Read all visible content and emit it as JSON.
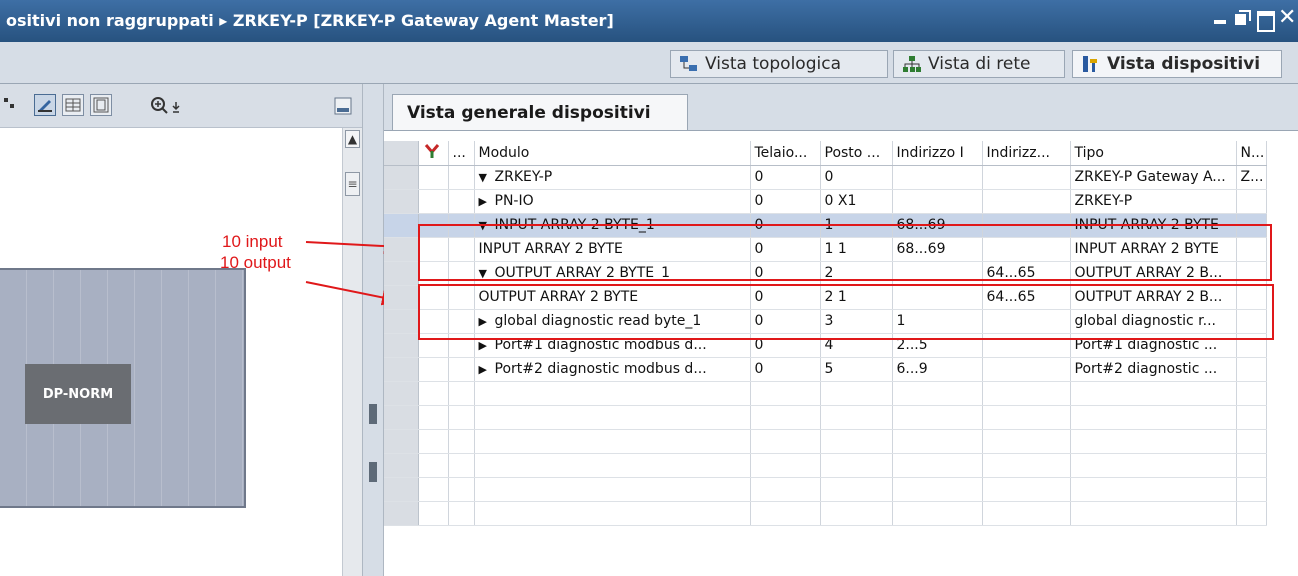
{
  "window": {
    "title": "ositivi non raggruppati ▸ ZRKEY-P [ZRKEY-P Gateway Agent Master]"
  },
  "view_tabs": [
    {
      "label": "Vista topologica",
      "icon": "topology-view-icon"
    },
    {
      "label": "Vista di rete",
      "icon": "network-view-icon"
    },
    {
      "label": "Vista dispositivi",
      "icon": "device-view-icon"
    }
  ],
  "left_panel": {
    "device_module_label": "DP-NORM",
    "annotations": [
      "10 input",
      "10 output"
    ]
  },
  "overview_tab": "Vista generale dispositivi",
  "table": {
    "columns": [
      "",
      "",
      "...",
      "Modulo",
      "Telaio...",
      "Posto ...",
      "Indirizzo I",
      "Indirizz...",
      "Tipo",
      "N..."
    ],
    "rows": [
      {
        "tree": "▼",
        "modulo": "ZRKEY-P",
        "telaio": "0",
        "posto": "0",
        "in": "",
        "out": "",
        "tipo": "ZRKEY-P Gateway A...",
        "n": "Z...",
        "level": 0
      },
      {
        "tree": "▶",
        "modulo": "PN-IO",
        "telaio": "0",
        "posto": "0 X1",
        "in": "",
        "out": "",
        "tipo": "ZRKEY-P",
        "n": "",
        "level": 1
      },
      {
        "tree": "▼",
        "modulo": "INPUT ARRAY 2 BYTE_1",
        "telaio": "0",
        "posto": "1",
        "in": "68...69",
        "out": "",
        "tipo": "INPUT ARRAY 2 BYTE",
        "n": "",
        "level": 0,
        "selected": true
      },
      {
        "tree": "",
        "modulo": "INPUT ARRAY 2 BYTE",
        "telaio": "0",
        "posto": "1 1",
        "in": "68...69",
        "out": "",
        "tipo": "INPUT ARRAY 2 BYTE",
        "n": "",
        "level": 2
      },
      {
        "tree": "▼",
        "modulo": "OUTPUT ARRAY 2 BYTE_1",
        "telaio": "0",
        "posto": "2",
        "in": "",
        "out": "64...65",
        "tipo": "OUTPUT ARRAY 2 B...",
        "n": "",
        "level": 0
      },
      {
        "tree": "",
        "modulo": "OUTPUT ARRAY 2 BYTE",
        "telaio": "0",
        "posto": "2 1",
        "in": "",
        "out": "64...65",
        "tipo": "OUTPUT ARRAY 2 B...",
        "n": "",
        "level": 2
      },
      {
        "tree": "▶",
        "modulo": "global diagnostic read byte_1",
        "telaio": "0",
        "posto": "3",
        "in": "1",
        "out": "",
        "tipo": "global diagnostic r...",
        "n": "",
        "level": 0
      },
      {
        "tree": "▶",
        "modulo": "Port#1 diagnostic modbus d...",
        "telaio": "0",
        "posto": "4",
        "in": "2...5",
        "out": "",
        "tipo": "Port#1 diagnostic ...",
        "n": "",
        "level": 0
      },
      {
        "tree": "▶",
        "modulo": "Port#2 diagnostic modbus d...",
        "telaio": "0",
        "posto": "5",
        "in": "6...9",
        "out": "",
        "tipo": "Port#2 diagnostic ...",
        "n": "",
        "level": 0
      }
    ]
  },
  "colors": {
    "titlebar": "#27527f",
    "annotation": "#e0181a",
    "selected_row": "#c7d4e8"
  }
}
